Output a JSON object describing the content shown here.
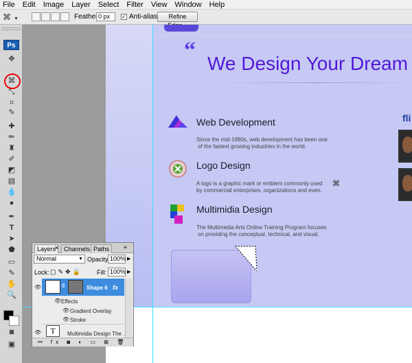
{
  "menu": [
    "File",
    "Edit",
    "Image",
    "Layer",
    "Select",
    "Filter",
    "View",
    "Window",
    "Help"
  ],
  "options": {
    "feather_label": "Feather:",
    "feather_value": "0 px",
    "antialias_label": "Anti-alias",
    "refine_edge": "Refine Edge..."
  },
  "toolbox": {
    "logo": "Ps"
  },
  "canvas": {
    "headline": "We Design Your Dream",
    "quote_mark": "“",
    "side_heading": "fli",
    "services": [
      {
        "title": "Web Development",
        "desc1": "Since the mid-1990s, web development has been one",
        "desc2": "of the fastest growing industries in the world."
      },
      {
        "title": "Logo Design",
        "desc1": "A logo is a graphic mark or emblem commonly used",
        "desc2": "by commercial enterprises, organizations and even."
      },
      {
        "title": "Multimidia Design",
        "desc1": "The Multimedia Arts Online Training Program focuses",
        "desc2": "on providing the conceptual, technical, and visual."
      }
    ]
  },
  "layers_panel": {
    "tabs": [
      "Layers",
      "Channels",
      "Paths"
    ],
    "blend_mode": "Normal",
    "opacity_label": "Opacity:",
    "opacity": "100%",
    "lock_label": "Lock:",
    "fill_label": "Fill:",
    "fill": "100%",
    "selected_layer": "Shape 6",
    "effects_label": "Effects",
    "effects": [
      "Gradient Overlay",
      "Stroke"
    ],
    "text_layer": "Multimidia Design  The ...",
    "text_layer_glyph": "T"
  },
  "colors": {
    "headline": "#5218d6",
    "selection_blue": "#3d8ce0",
    "highlight_circle": "#e00000"
  }
}
